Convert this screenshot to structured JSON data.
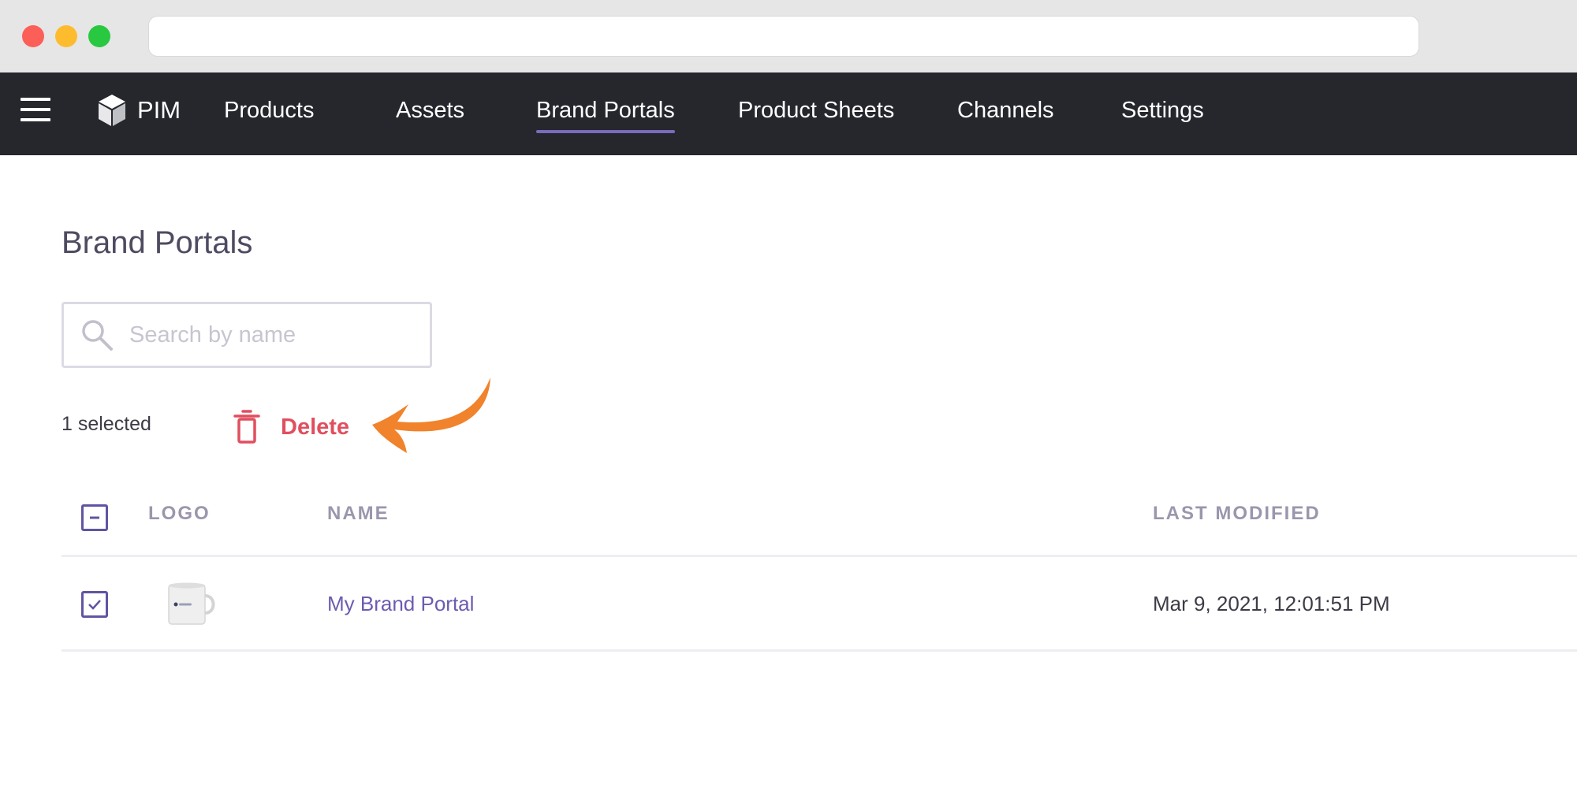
{
  "nav": {
    "brand": "PIM",
    "items": [
      {
        "label": "Products"
      },
      {
        "label": "Assets"
      },
      {
        "label": "Brand Portals",
        "active": true
      },
      {
        "label": "Product Sheets"
      },
      {
        "label": "Channels"
      },
      {
        "label": "Settings"
      }
    ]
  },
  "page": {
    "title": "Brand Portals",
    "search_placeholder": "Search by name"
  },
  "selection": {
    "count_text": "1 selected",
    "delete_label": "Delete"
  },
  "table": {
    "columns": [
      "LOGO",
      "NAME",
      "LAST MODIFIED"
    ],
    "rows": [
      {
        "name": "My Brand Portal",
        "last_modified": "Mar 9, 2021, 12:01:51 PM",
        "selected": true
      }
    ]
  },
  "colors": {
    "nav_background": "#25272d",
    "accent": "#7a6bbd",
    "delete": "#e04f5f",
    "annotation_arrow": "#f0832b"
  },
  "icons": [
    "hamburger-icon",
    "cube-icon",
    "search-icon",
    "trash-icon",
    "checkbox-indeterminate-icon",
    "checkbox-checked-icon",
    "annotation-arrow-icon"
  ]
}
